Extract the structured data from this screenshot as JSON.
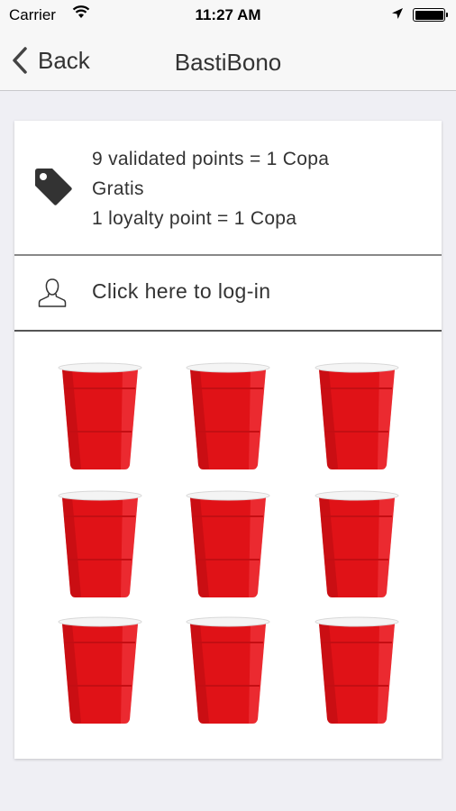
{
  "status_bar": {
    "carrier": "Carrier",
    "time": "11:27 AM"
  },
  "nav": {
    "back_label": "Back",
    "title": "BastiBono"
  },
  "info": {
    "line1": "9 validated points = 1 Copa",
    "line2": "Gratis",
    "line3": "1 loyalty point = 1 Copa",
    "icon": "tag-icon"
  },
  "login": {
    "label": "Click here to log-in",
    "icon": "user-icon"
  },
  "stamps": {
    "total": 9,
    "icon": "red-cup",
    "color": "#e01217"
  },
  "colors": {
    "background": "#efeff4",
    "navbar": "#f7f7f7",
    "cup_red": "#e01217"
  }
}
